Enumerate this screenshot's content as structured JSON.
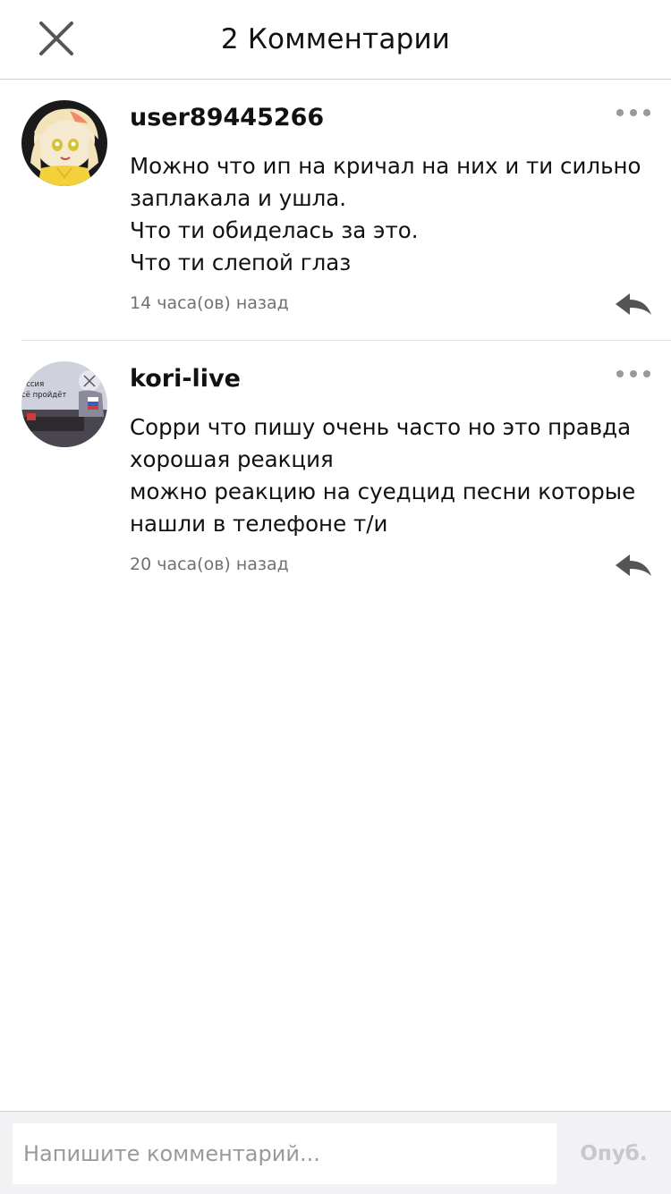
{
  "header": {
    "title": "2 Комментарии",
    "close_icon": "close-icon"
  },
  "comments": [
    {
      "username": "user89445266",
      "avatar_icon": "avatar-anime-character",
      "lines": [
        "Можно что ип на кричал на них и ти сильно",
        "заплакала и ушла.",
        "Что ти обиделась за это.",
        "Что ти слепой глаз"
      ],
      "timestamp": "14 часа(ов) назад",
      "more_icon": "more-dots-icon",
      "reply_icon": "reply-arrow-icon"
    },
    {
      "username": "kori-live",
      "avatar_icon": "avatar-anime-scene",
      "avatar_text": [
        "оссия",
        "сё пройдёт"
      ],
      "lines": [
        "Сорри что пишу очень часто но это правда",
        "хорошая реакция",
        "можно реакцию на суедцид песни которые",
        "нашли в телефоне т/и"
      ],
      "timestamp": "20 часа(ов) назад",
      "more_icon": "more-dots-icon",
      "reply_icon": "reply-arrow-icon"
    }
  ],
  "footer": {
    "input_placeholder": "Напишите комментарий...",
    "input_value": "",
    "publish_label": "Опуб."
  },
  "colors": {
    "text": "#111111",
    "timestamp": "#707070",
    "icon": "#555555",
    "dots": "#999999",
    "footer_bg": "#f2f2f4",
    "publish_disabled": "#c8c8cc"
  }
}
